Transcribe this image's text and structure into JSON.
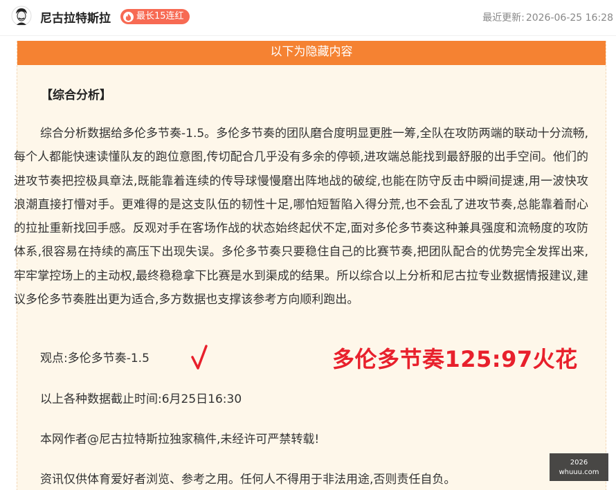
{
  "header": {
    "author": "尼古拉特斯拉",
    "badge": "最长15连红",
    "updated_label": "最近更新:",
    "updated_time": "2026-06-25 16:28"
  },
  "hidden_bar": "以下为隐藏内容",
  "article": {
    "section_title": "【综合分析】",
    "paragraph": "综合分析数据给多伦多节奏-1.5。多伦多节奏的团队磨合度明显更胜一筹,全队在攻防两端的联动十分流畅,每个人都能快速读懂队友的跑位意图,传切配合几乎没有多余的停顿,进攻端总能找到最舒服的出手空间。他们的进攻节奏把控极具章法,既能靠着连续的传导球慢慢磨出阵地战的破绽,也能在防守反击中瞬间提速,用一波快攻浪潮直接打懵对手。更难得的是这支队伍的韧性十足,哪怕短暂陷入得分荒,也不会乱了进攻节奏,总能靠着耐心的拉扯重新找回手感。反观对手在客场作战的状态始终起伏不定,面对多伦多节奏这种兼具强度和流畅度的攻防体系,很容易在持续的高压下出现失误。多伦多节奏只要稳住自己的比赛节奏,把团队配合的优势完全发挥出来,牢牢掌控场上的主动权,最终稳稳拿下比赛是水到渠成的结果。所以综合以上分析和尼古拉专业数据情报建议,建议多伦多节奏胜出更为适合,多方数据也支撑该参考方向顺利跑出。",
    "viewpoint": "观点:多伦多节奏-1.5",
    "result": "多伦多节奏125:97火花",
    "cutoff": "以上各种数据截止时间:6月25日16:30",
    "copyright": "本网作者@尼古拉特斯拉独家稿件,未经许可严禁转载!",
    "disclaimer": "资讯仅供体育爱好者浏览、参考之用。任何人不得用于非法用途,否则责任自负。"
  },
  "watermark": {
    "line1": "2026",
    "line2": "whuuu.com"
  },
  "colors": {
    "accent_orange": "#f58232",
    "badge_red": "#f76a53",
    "result_red": "#e8202c",
    "panel_bg": "#fef7ea"
  }
}
